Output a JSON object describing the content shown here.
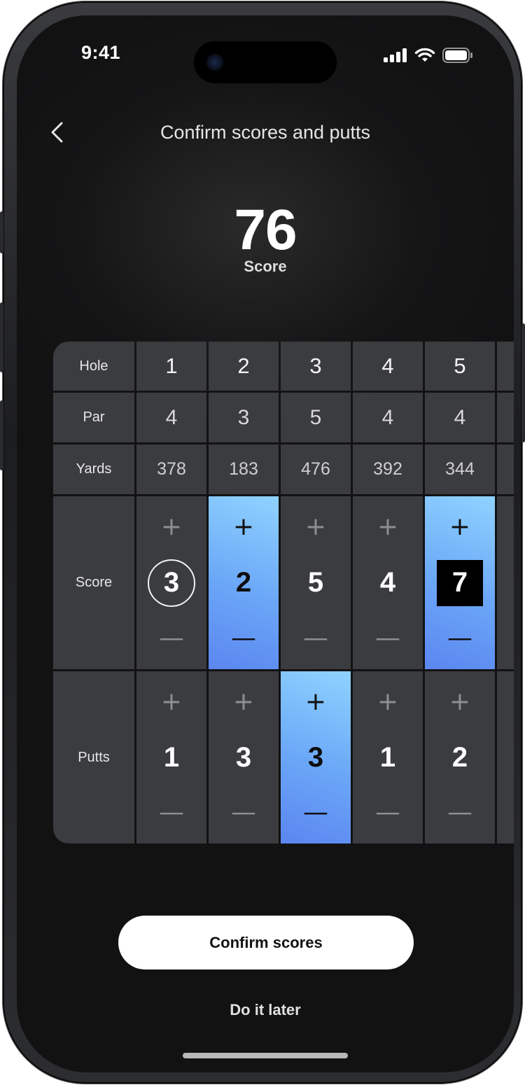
{
  "status_bar": {
    "time": "9:41"
  },
  "header": {
    "title": "Confirm scores and putts"
  },
  "summary": {
    "total": "76",
    "label": "Score"
  },
  "table": {
    "row_labels": {
      "hole": "Hole",
      "par": "Par",
      "yards": "Yards",
      "score": "Score",
      "putts": "Putts"
    },
    "holes": [
      {
        "hole": "1",
        "par": "4",
        "yards": "378",
        "score": "3",
        "putts": "1"
      },
      {
        "hole": "2",
        "par": "3",
        "yards": "183",
        "score": "2",
        "putts": "3"
      },
      {
        "hole": "3",
        "par": "5",
        "yards": "476",
        "score": "5",
        "putts": "3"
      },
      {
        "hole": "4",
        "par": "4",
        "yards": "392",
        "score": "4",
        "putts": "1"
      },
      {
        "hole": "5",
        "par": "4",
        "yards": "344",
        "score": "7",
        "putts": "2"
      }
    ],
    "stepper_symbols": {
      "plus": "+",
      "minus": "—"
    }
  },
  "actions": {
    "confirm_label": "Confirm scores",
    "later_label": "Do it later"
  },
  "colors": {
    "highlight_start": "#8fd3ff",
    "highlight_end": "#5b86f0",
    "cell": "#3b3c40"
  }
}
